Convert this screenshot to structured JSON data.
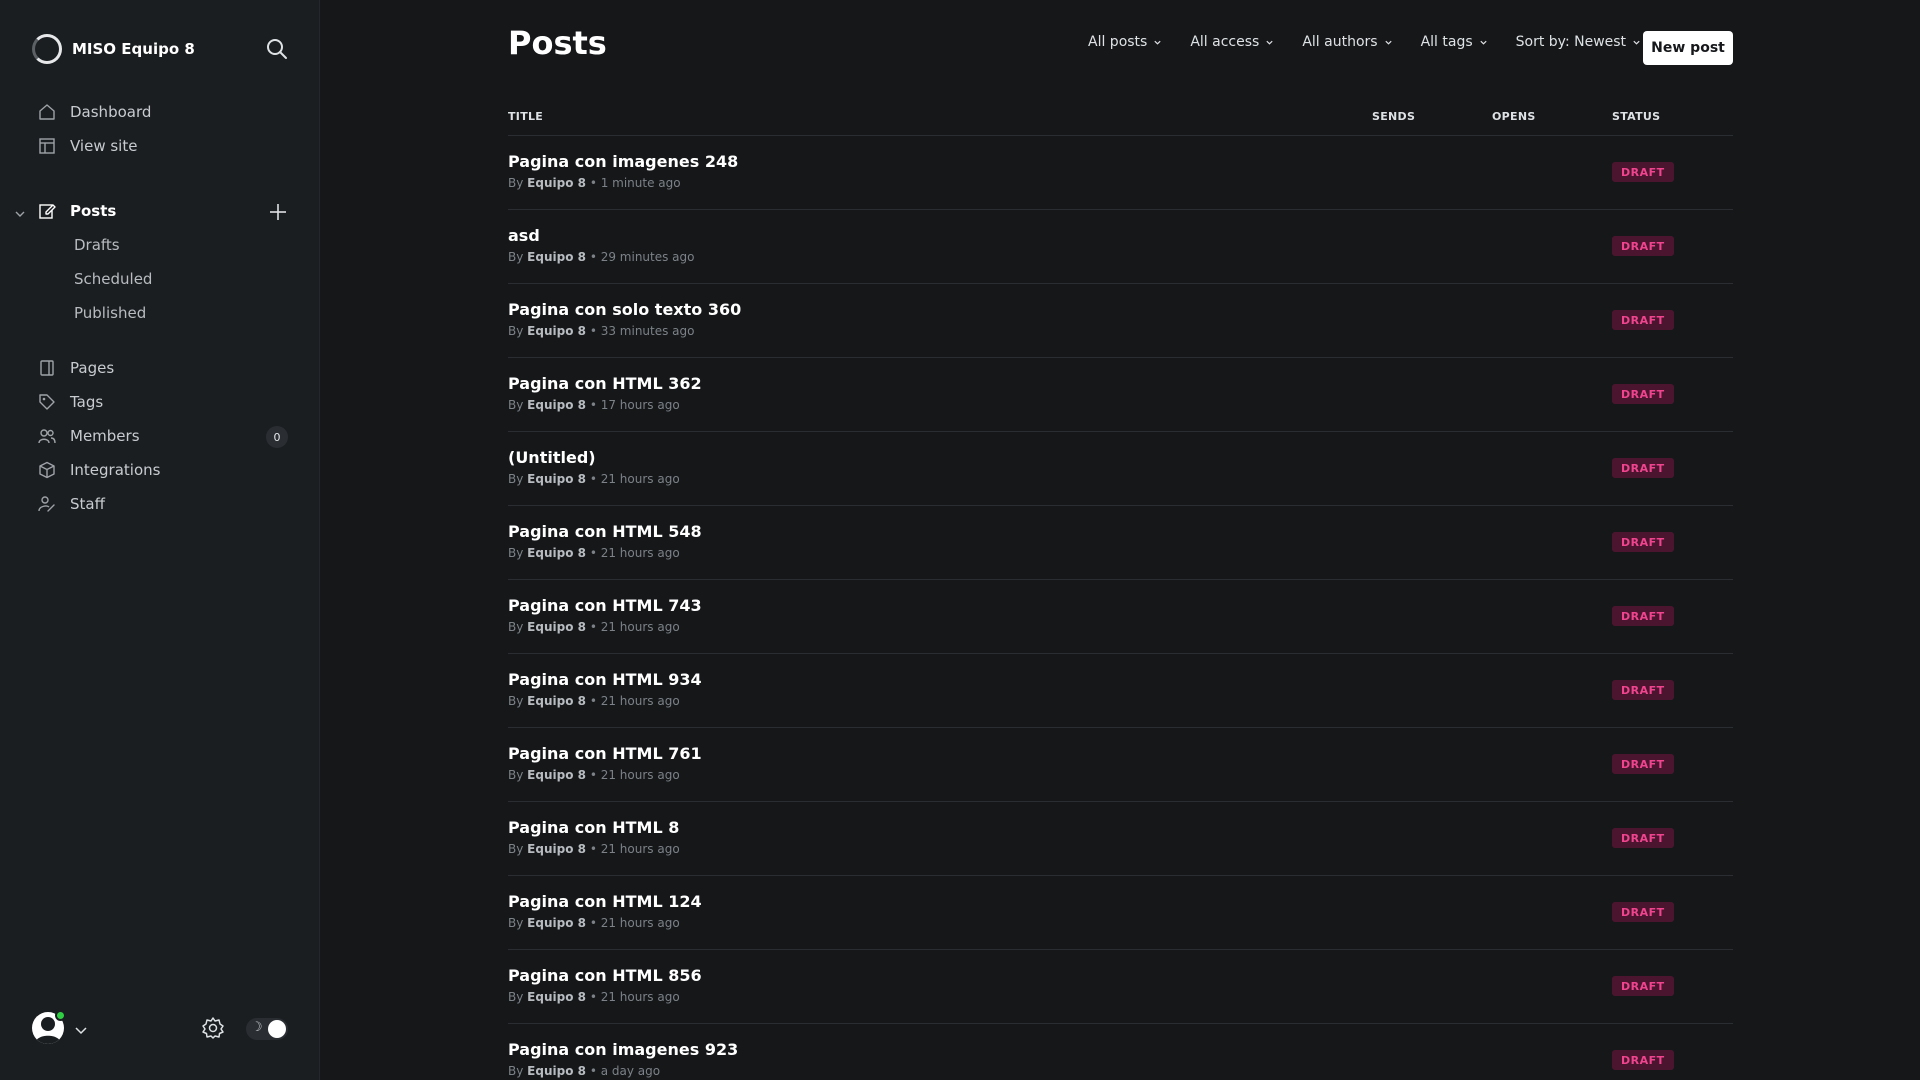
{
  "brand": {
    "name": "MISO Equipo 8"
  },
  "nav": {
    "top": [
      {
        "label": "Dashboard",
        "icon": "home-icon"
      },
      {
        "label": "View site",
        "icon": "layout-icon"
      }
    ],
    "posts": {
      "label": "Posts",
      "icon": "edit-icon"
    },
    "posts_sub": [
      "Drafts",
      "Scheduled",
      "Published"
    ],
    "bottom": [
      {
        "label": "Pages",
        "icon": "page-icon"
      },
      {
        "label": "Tags",
        "icon": "tag-icon"
      },
      {
        "label": "Members",
        "icon": "members-icon",
        "count": "0"
      },
      {
        "label": "Integrations",
        "icon": "box-icon"
      },
      {
        "label": "Staff",
        "icon": "staff-icon"
      }
    ]
  },
  "toolbar": {
    "title": "Posts",
    "filters": [
      "All posts",
      "All access",
      "All authors",
      "All tags",
      "Sort by: Newest"
    ],
    "new_post": "New post"
  },
  "table": {
    "columns": {
      "title": "TITLE",
      "sends": "SENDS",
      "opens": "OPENS",
      "status": "STATUS"
    },
    "rows": [
      {
        "title": "Pagina con imagenes 248",
        "by": "By",
        "author": "Equipo 8",
        "time": "• 1 minute ago",
        "status": "DRAFT"
      },
      {
        "title": "asd",
        "by": "By",
        "author": "Equipo 8",
        "time": "• 29 minutes ago",
        "status": "DRAFT"
      },
      {
        "title": "Pagina con solo texto 360",
        "by": "By",
        "author": "Equipo 8",
        "time": "• 33 minutes ago",
        "status": "DRAFT"
      },
      {
        "title": "Pagina con HTML 362",
        "by": "By",
        "author": "Equipo 8",
        "time": "• 17 hours ago",
        "status": "DRAFT"
      },
      {
        "title": "(Untitled)",
        "by": "By",
        "author": "Equipo 8",
        "time": "• 21 hours ago",
        "status": "DRAFT"
      },
      {
        "title": "Pagina con HTML 548",
        "by": "By",
        "author": "Equipo 8",
        "time": "• 21 hours ago",
        "status": "DRAFT"
      },
      {
        "title": "Pagina con HTML 743",
        "by": "By",
        "author": "Equipo 8",
        "time": "• 21 hours ago",
        "status": "DRAFT"
      },
      {
        "title": "Pagina con HTML 934",
        "by": "By",
        "author": "Equipo 8",
        "time": "• 21 hours ago",
        "status": "DRAFT"
      },
      {
        "title": "Pagina con HTML 761",
        "by": "By",
        "author": "Equipo 8",
        "time": "• 21 hours ago",
        "status": "DRAFT"
      },
      {
        "title": "Pagina con HTML 8",
        "by": "By",
        "author": "Equipo 8",
        "time": "• 21 hours ago",
        "status": "DRAFT"
      },
      {
        "title": "Pagina con HTML 124",
        "by": "By",
        "author": "Equipo 8",
        "time": "• 21 hours ago",
        "status": "DRAFT"
      },
      {
        "title": "Pagina con HTML 856",
        "by": "By",
        "author": "Equipo 8",
        "time": "• 21 hours ago",
        "status": "DRAFT"
      },
      {
        "title": "Pagina con imagenes 923",
        "by": "By",
        "author": "Equipo 8",
        "time": "• a day ago",
        "status": "DRAFT"
      }
    ]
  },
  "footer": {
    "theme_toggle": "☽"
  },
  "colors": {
    "background": "#151719",
    "sidebar": "#1b1e21",
    "draft_text": "#f0448f",
    "draft_bg": "#4b1530",
    "online": "#30cf43"
  }
}
